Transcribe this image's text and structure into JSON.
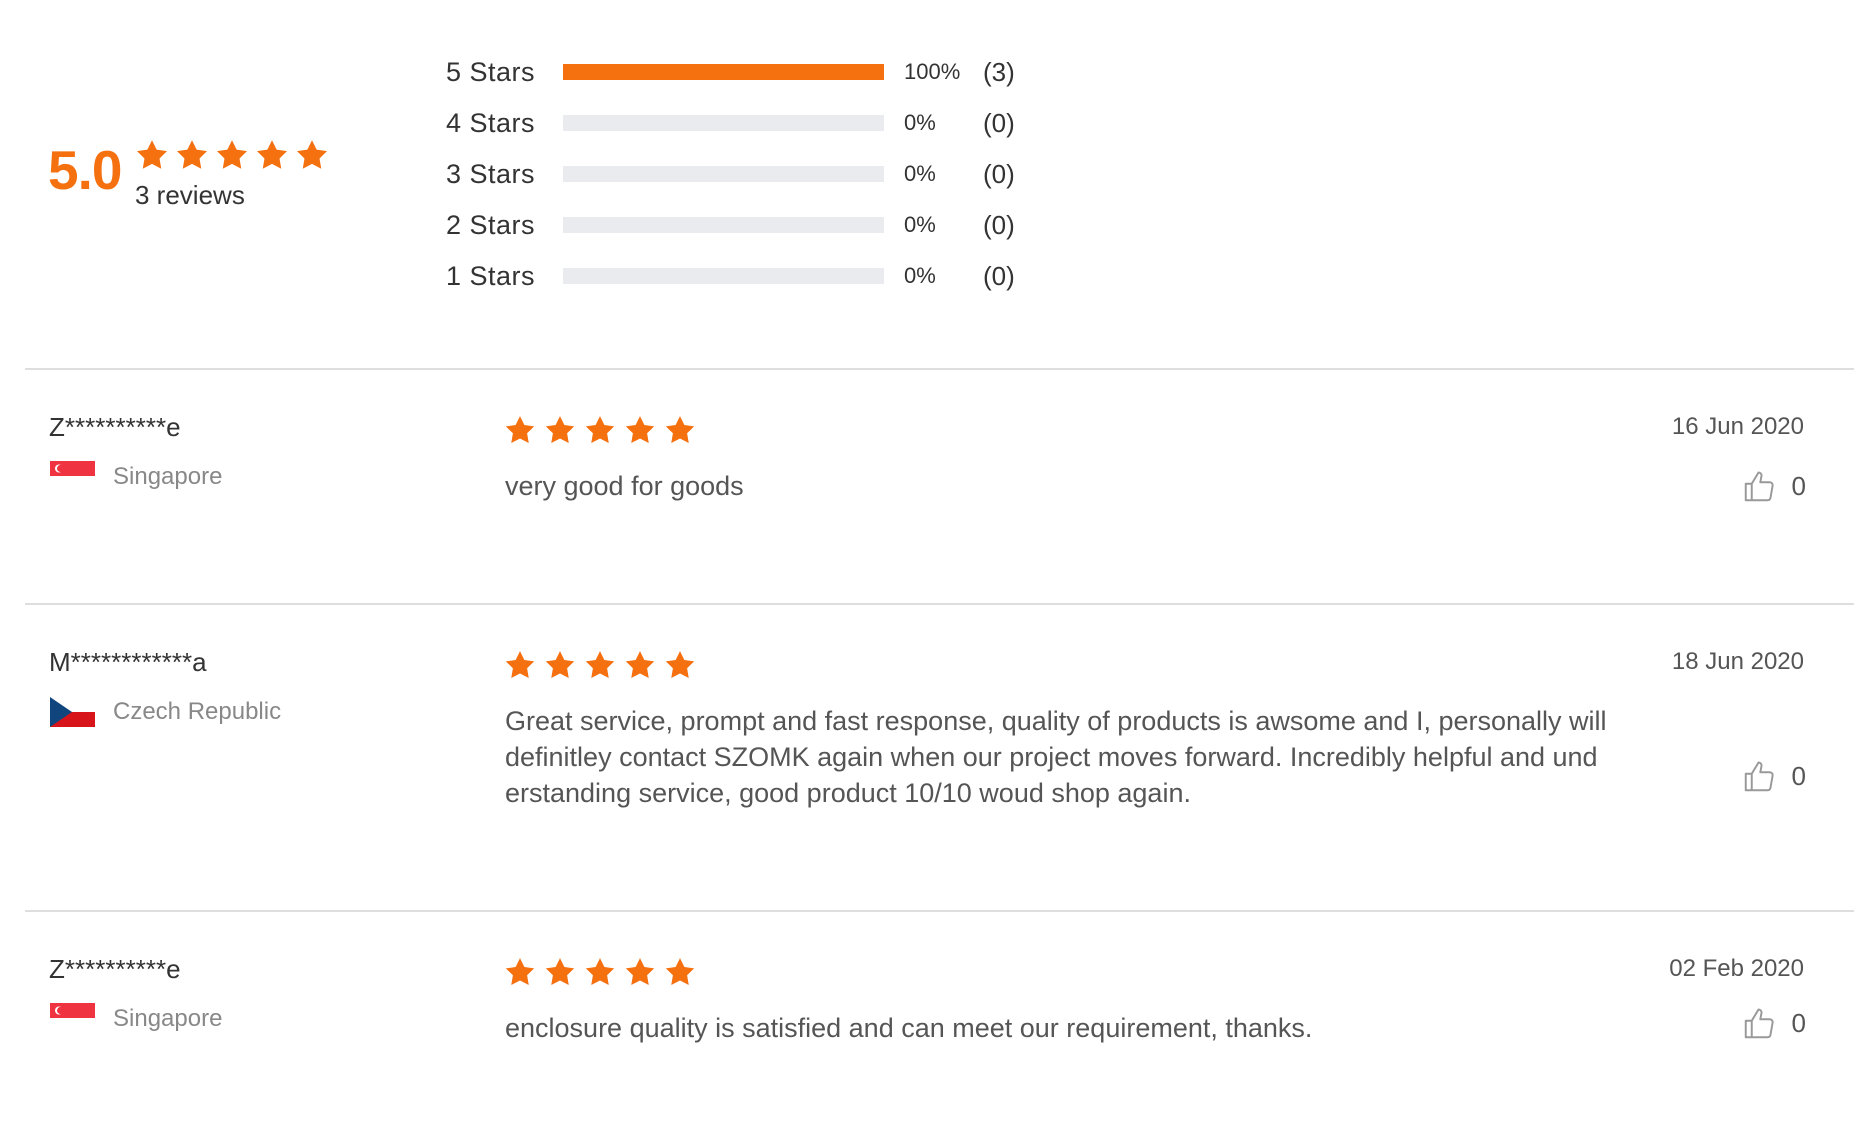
{
  "summary": {
    "average": "5.0",
    "average_stars": 5,
    "review_count_label": "3 reviews",
    "distribution": [
      {
        "label": "5  Stars",
        "fraction": 1.0,
        "pct": "100%",
        "count": "(3)"
      },
      {
        "label": "4  Stars",
        "fraction": 0.0,
        "pct": "0%",
        "count": "(0)"
      },
      {
        "label": "3  Stars",
        "fraction": 0.0,
        "pct": "0%",
        "count": "(0)"
      },
      {
        "label": "2  Stars",
        "fraction": 0.0,
        "pct": "0%",
        "count": "(0)"
      },
      {
        "label": "1  Stars",
        "fraction": 0.0,
        "pct": "0%",
        "count": "(0)"
      }
    ]
  },
  "reviews": [
    {
      "user": "Z**********e",
      "country": "Singapore",
      "flag_icon": "singapore-flag-icon",
      "rating": 5,
      "text": "very good for goods",
      "date": "16 Jun 2020",
      "likes": "0"
    },
    {
      "user": "M************a",
      "country": "Czech Republic",
      "flag_icon": "czech-flag-icon",
      "rating": 5,
      "text_lines": [
        "Great service, prompt and fast response, quality of products is awsome and I, personally will",
        "definitley contact SZOMK again when our project moves forward. Incredibly helpful and und",
        "erstanding service, good product 10/10 woud shop again."
      ],
      "date": "18 Jun 2020",
      "likes": "0"
    },
    {
      "user": "Z**********e",
      "country": "Singapore",
      "flag_icon": "singapore-flag-icon",
      "rating": 5,
      "text": "enclosure quality is satisfied and can meet our requirement, thanks.",
      "date": "02 Feb 2020",
      "likes": "0"
    }
  ],
  "colors": {
    "accent": "#f5700f",
    "track": "#e9ebee",
    "divider": "#dedede"
  },
  "icons": {
    "star": "star-icon",
    "like": "thumbs-up-icon"
  }
}
